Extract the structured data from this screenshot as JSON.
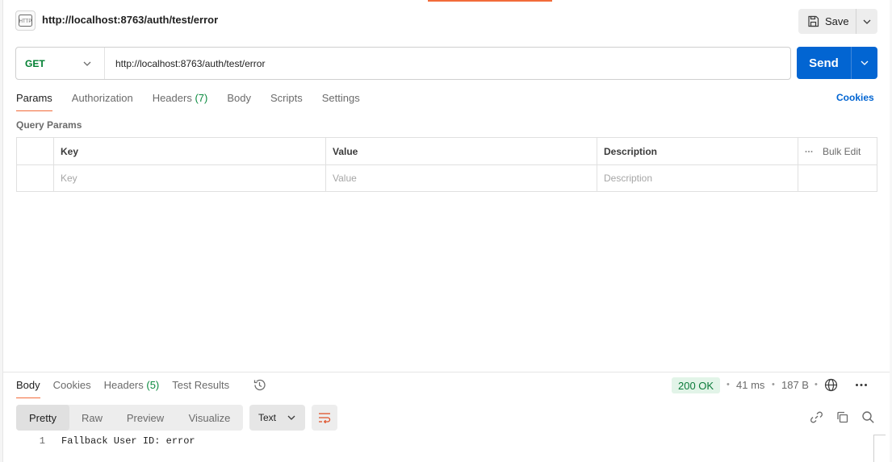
{
  "request": {
    "title": "http://localhost:8763/auth/test/error",
    "method": "GET",
    "url": "http://localhost:8763/auth/test/error",
    "save_label": "Save",
    "send_label": "Send"
  },
  "request_tabs": [
    {
      "label": "Params",
      "count": ""
    },
    {
      "label": "Authorization",
      "count": ""
    },
    {
      "label": "Headers",
      "count": "(7)"
    },
    {
      "label": "Body",
      "count": ""
    },
    {
      "label": "Scripts",
      "count": ""
    },
    {
      "label": "Settings",
      "count": ""
    }
  ],
  "cookies_label": "Cookies",
  "query_params": {
    "title": "Query Params",
    "columns": [
      "Key",
      "Value",
      "Description"
    ],
    "bulk_edit": "Bulk Edit",
    "placeholders": {
      "key": "Key",
      "value": "Value",
      "description": "Description"
    }
  },
  "response": {
    "tabs": [
      {
        "label": "Body",
        "count": ""
      },
      {
        "label": "Cookies",
        "count": ""
      },
      {
        "label": "Headers",
        "count": "(5)"
      },
      {
        "label": "Test Results",
        "count": ""
      }
    ],
    "status": "200 OK",
    "time": "41 ms",
    "size": "187 B",
    "views": [
      "Pretty",
      "Raw",
      "Preview",
      "Visualize"
    ],
    "format": "Text",
    "lines": [
      {
        "no": "1",
        "text": "Fallback User ID: error"
      }
    ]
  },
  "icons": {
    "http": "http-request-icon",
    "save": "floppy-disk-icon",
    "history": "history-icon",
    "globe": "globe-icon",
    "more": "more-horizontal-icon",
    "wrap": "wrap-lines-icon",
    "link": "link-icon",
    "copy": "copy-icon",
    "search": "search-icon"
  },
  "colors": {
    "accent": "#f26b3a",
    "send": "#0265d2",
    "method_get": "#007f31",
    "status_ok_bg": "#e2f4e8",
    "status_ok_text": "#0a7a39"
  }
}
